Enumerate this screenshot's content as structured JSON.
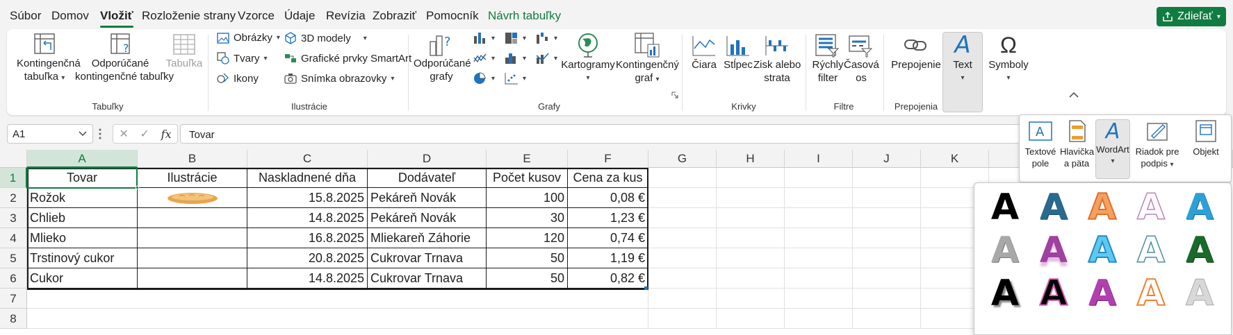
{
  "menu": {
    "items": [
      "Súbor",
      "Domov",
      "Vložiť",
      "Rozloženie strany",
      "Vzorce",
      "Údaje",
      "Revízia",
      "Zobraziť",
      "Pomocník",
      "Návrh tabuľky"
    ],
    "share": "Zdieľať"
  },
  "ribbon": {
    "tables": {
      "pivot_line1": "Kontingenčná",
      "pivot_line2": "tabuľka",
      "rec_pivot_line1": "Odporúčané",
      "rec_pivot_line2": "kontingenčné tabuľky",
      "table": "Tabuľka",
      "label": "Tabuľky"
    },
    "illustrations": {
      "pictures": "Obrázky",
      "shapes": "Tvary",
      "icons": "Ikony",
      "models3d": "3D modely",
      "smartart": "Grafické prvky SmartArt",
      "screenshot": "Snímka obrazovky",
      "label": "Ilustrácie"
    },
    "charts": {
      "rec_line1": "Odporúčané",
      "rec_line2": "grafy",
      "maps": "Kartogramy",
      "pivotchart_line1": "Kontingenčný",
      "pivotchart_line2": "graf",
      "label": "Grafy"
    },
    "sparklines": {
      "line": "Čiara",
      "column": "Stĺpec",
      "winloss_line1": "Zisk alebo",
      "winloss_line2": "strata",
      "label": "Krivky"
    },
    "filters": {
      "slicer_line1": "Rýchly",
      "slicer_line2": "filter",
      "timeline_line1": "Časová",
      "timeline_line2": "os",
      "label": "Filtre"
    },
    "links": {
      "link": "Prepojenie",
      "label": "Prepojenia"
    },
    "text": {
      "label": "Text"
    },
    "symbols": {
      "label": "Symboly"
    }
  },
  "formula_bar": {
    "name_box": "A1",
    "fx": "fx",
    "formula": "Tovar"
  },
  "sheet": {
    "columns": [
      "A",
      "B",
      "C",
      "D",
      "E",
      "F",
      "G",
      "H",
      "I",
      "J",
      "K"
    ],
    "rows": [
      "1",
      "2",
      "3",
      "4",
      "5",
      "6",
      "7",
      "8"
    ],
    "header": [
      "Tovar",
      "Ilustrácie",
      "Naskladnené dňa",
      "Dodávateľ",
      "Počet kusov",
      "Cena za kus"
    ],
    "data": [
      [
        "Rožok",
        "",
        "15.8.2025",
        "Pekáreň Novák",
        "100",
        "0,08 €"
      ],
      [
        "Chlieb",
        "",
        "14.8.2025",
        "Pekáreň Novák",
        "30",
        "1,23 €"
      ],
      [
        "Mlieko",
        "",
        "16.8.2025",
        "Mliekareň Záhorie",
        "120",
        "0,74 €"
      ],
      [
        "Trstinový cukor",
        "",
        "20.8.2025",
        "Cukrovar Trnava",
        "50",
        "1,19 €"
      ],
      [
        "Cukor",
        "",
        "14.8.2025",
        "Cukrovar Trnava",
        "50",
        "0,82 €"
      ]
    ]
  },
  "text_panel": {
    "textbox_line1": "Textové",
    "textbox_line2": "pole",
    "header_line1": "Hlavička",
    "header_line2": "a päta",
    "wordart": "WordArt",
    "signature_line1": "Riadok pre",
    "signature_line2": "podpis",
    "object": "Objekt"
  },
  "wordart_letter": "A",
  "colors": {
    "accent": "#107c41",
    "selection_header": "#d3e5d9"
  }
}
